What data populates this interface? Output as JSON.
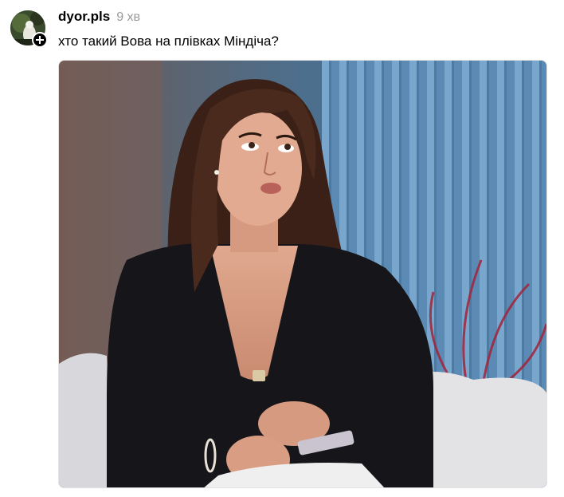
{
  "post": {
    "username": "dyor.pls",
    "timestamp": "9 хв",
    "text": "хто такий Вова на плівках Міндіча?"
  },
  "icons": {
    "avatar": "avatar-icon",
    "follow": "plus-icon"
  },
  "colors": {
    "username": "#000000",
    "timestamp": "#999999",
    "badge": "#000000",
    "background": "#ffffff"
  }
}
